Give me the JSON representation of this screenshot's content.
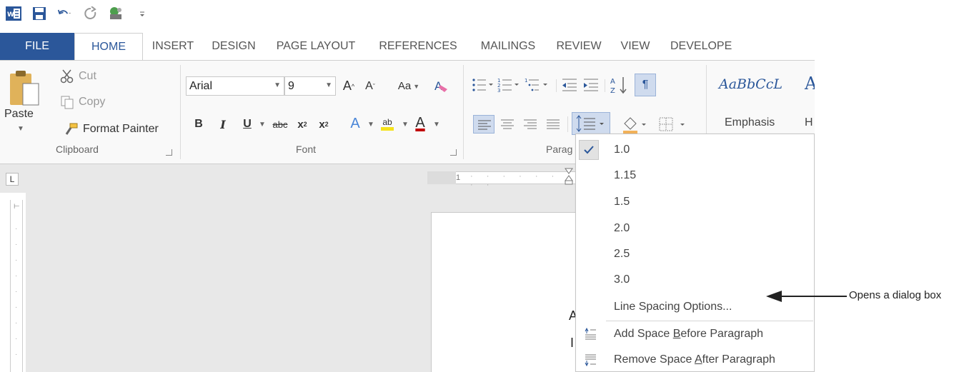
{
  "tabs": [
    "FILE",
    "HOME",
    "INSERT",
    "DESIGN",
    "PAGE LAYOUT",
    "REFERENCES",
    "MAILINGS",
    "REVIEW",
    "VIEW",
    "DEVELOPE"
  ],
  "clipboard": {
    "paste": "Paste",
    "cut": "Cut",
    "copy": "Copy",
    "format_painter": "Format Painter",
    "label": "Clipboard"
  },
  "font": {
    "name": "Arial",
    "size": "9",
    "grow": "A",
    "shrink": "A",
    "case": "Aa",
    "bold": "B",
    "italic": "I",
    "underline": "U",
    "strike": "abc",
    "subscript": "x",
    "subscript_mark": "2",
    "superscript": "x",
    "superscript_mark": "2",
    "effects": "A",
    "highlight": "ab",
    "color": "A",
    "label": "Font"
  },
  "paragraph": {
    "label": "Parag",
    "show_marks": "¶"
  },
  "styles": {
    "sample": "AaBbCcL",
    "sample_next": "A",
    "emphasis": "Emphasis",
    "next_label": "H"
  },
  "ruler": {
    "tab_marker": "L",
    "mark": "1"
  },
  "menu": {
    "spacing_options": [
      "1.0",
      "1.15",
      "1.5",
      "2.0",
      "2.5",
      "3.0"
    ],
    "selected": "1.0",
    "line_spacing_options": "Line Spacing Options...",
    "add_before_pre": "Add Space ",
    "add_before_key": "B",
    "add_before_post": "efore Paragraph",
    "remove_after_pre": "Remove Space ",
    "remove_after_key": "A",
    "remove_after_post": "fter Paragraph"
  },
  "doc_letters": [
    "A",
    "I"
  ],
  "annotation": "Opens a dialog box",
  "colors": {
    "word_blue": "#2b579a",
    "highlight_yellow": "#f5e21b",
    "font_red": "#c00000",
    "selected_blue": "#cfdbee"
  }
}
